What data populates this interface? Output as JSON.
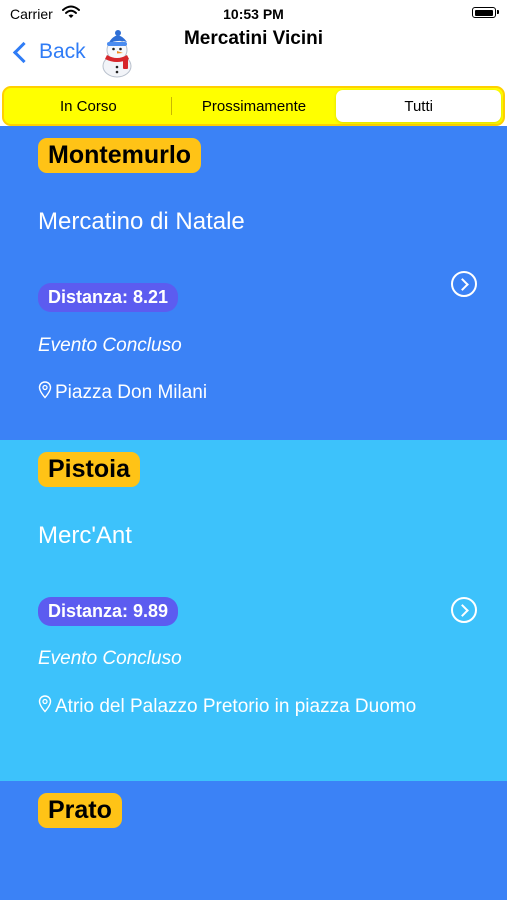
{
  "status_bar": {
    "carrier": "Carrier",
    "time": "10:53 PM"
  },
  "nav": {
    "back_label": "Back",
    "title": "Mercatini Vicini",
    "logo_icon": "snowman-icon"
  },
  "segments": [
    {
      "label": "In Corso",
      "selected": false
    },
    {
      "label": "Prossimamente",
      "selected": false
    },
    {
      "label": "Tutti",
      "selected": true
    }
  ],
  "colors": {
    "row_dark_blue": "#3b82f6",
    "row_light_blue": "#3dc2fb",
    "city_badge": "#ffc316",
    "distance_badge": "#5c5cf0",
    "segment_background": "#ffff00",
    "accent": "#2f7cf6"
  },
  "markets": [
    {
      "city": "Montemurlo",
      "name": "Mercatino di Natale",
      "distance": "Distanza: 8.21",
      "status": "Evento Concluso",
      "address": "Piazza Don Milani"
    },
    {
      "city": "Pistoia",
      "name": "Merc'Ant",
      "distance": "Distanza: 9.89",
      "status": "Evento Concluso",
      "address": "Atrio del Palazzo Pretorio in piazza Duomo"
    },
    {
      "city": "Prato"
    }
  ]
}
